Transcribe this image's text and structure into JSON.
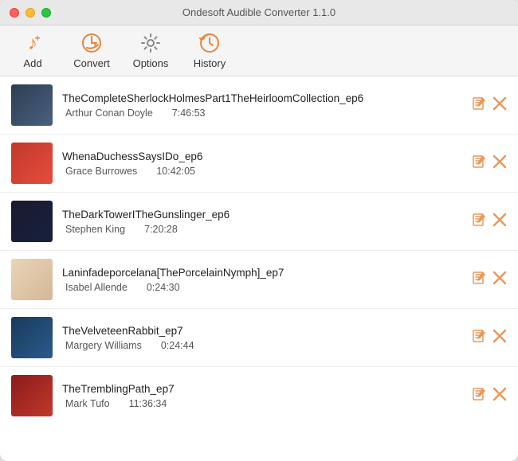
{
  "window": {
    "title": "Ondesoft Audible Converter 1.1.0"
  },
  "toolbar": {
    "add_label": "Add",
    "convert_label": "Convert",
    "options_label": "Options",
    "history_label": "History"
  },
  "books": [
    {
      "id": 1,
      "title": "TheCompleteSherlockHolmesPart1TheHeirloomCollection_ep6",
      "author": "Arthur Conan Doyle",
      "duration": "7:46:53",
      "cover_class": "cover-1"
    },
    {
      "id": 2,
      "title": "WhenaDuchessSaysIDo_ep6",
      "author": "Grace Burrowes",
      "duration": "10:42:05",
      "cover_class": "cover-2"
    },
    {
      "id": 3,
      "title": "TheDarkTowerITheGunslinger_ep6",
      "author": "Stephen King",
      "duration": "7:20:28",
      "cover_class": "cover-3"
    },
    {
      "id": 4,
      "title": "Laninfadeporcelana[ThePorcelainNymph]_ep7",
      "author": "Isabel Allende",
      "duration": "0:24:30",
      "cover_class": "cover-4"
    },
    {
      "id": 5,
      "title": "TheVelveteenRabbit_ep7",
      "author": "Margery Williams",
      "duration": "0:24:44",
      "cover_class": "cover-5"
    },
    {
      "id": 6,
      "title": "TheTremblingPath_ep7",
      "author": "Mark Tufo",
      "duration": "11:36:34",
      "cover_class": "cover-6"
    }
  ],
  "colors": {
    "accent": "#e8863a",
    "text_primary": "#222",
    "text_secondary": "#555"
  }
}
